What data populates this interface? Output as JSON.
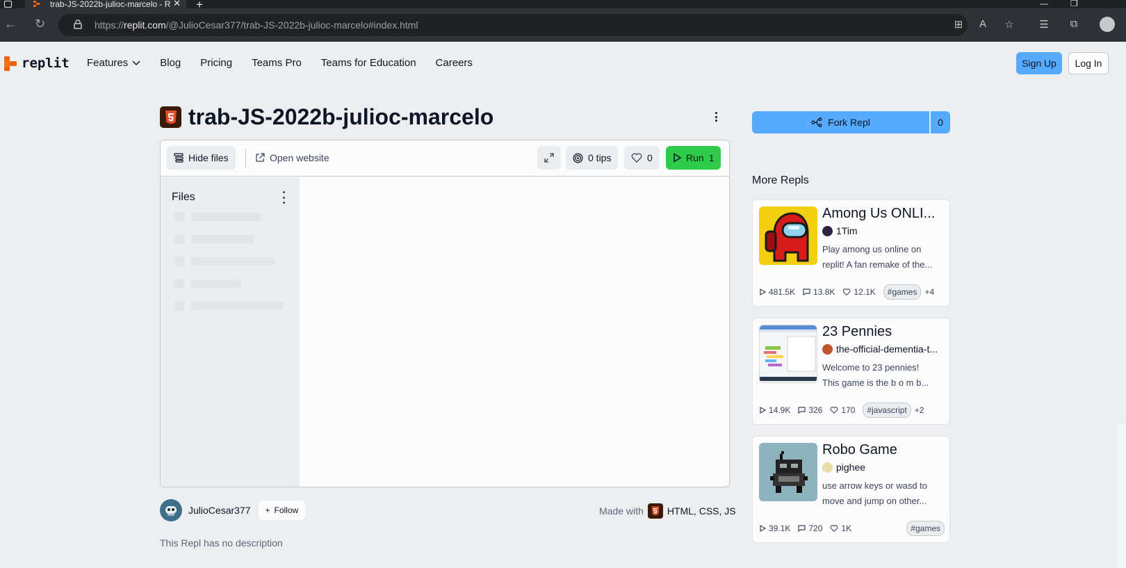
{
  "browser": {
    "tab_title": "trab-JS-2022b-julioc-marcelo - R",
    "url_prefix": "https://",
    "url_domain": "replit.com",
    "url_path": "/@JulioCesar377/trab-JS-2022b-julioc-marcelo#index.html"
  },
  "header": {
    "logo_text": "replit",
    "nav": [
      "Features",
      "Blog",
      "Pricing",
      "Teams Pro",
      "Teams for Education",
      "Careers"
    ],
    "signup": "Sign Up",
    "login": "Log In"
  },
  "repl": {
    "title": "trab-JS-2022b-julioc-marcelo",
    "hide_files": "Hide files",
    "open_website": "Open website",
    "tips": "0 tips",
    "likes": "0",
    "run_label": "Run",
    "run_count": "1",
    "files_title": "Files",
    "owner": "JulioCesar377",
    "follow": "Follow",
    "made_with_label": "Made with",
    "made_with_langs": "HTML, CSS, JS",
    "description": "This Repl has no description"
  },
  "sidebar": {
    "fork_label": "Fork Repl",
    "fork_count": "0",
    "more_title": "More Repls",
    "cards": [
      {
        "title": "Among Us ONLI...",
        "author": "1Tim",
        "desc1": "Play among us online on",
        "desc2": "replit! A fan remake of the...",
        "runs": "481.5K",
        "comments": "13.8K",
        "likes": "12.1K",
        "tag": "#games",
        "more_tags": "+4"
      },
      {
        "title": "23 Pennies",
        "author": "the-official-dementia-t...",
        "desc1": "Welcome to 23 pennies!",
        "desc2": "This game is the b o m b...",
        "runs": "14.9K",
        "comments": "326",
        "likes": "170",
        "tag": "#javascript",
        "more_tags": "+2"
      },
      {
        "title": "Robo Game",
        "author": "pighee",
        "desc1": "use arrow keys or wasd to",
        "desc2": "move and jump on other...",
        "runs": "39.1K",
        "comments": "720",
        "likes": "1K",
        "tag": "#games",
        "more_tags": ""
      }
    ]
  },
  "colors": {
    "accent_blue": "#57abff",
    "run_green": "#2ecc4a",
    "replit_orange": "#f26207",
    "page_bg": "#eceef0"
  }
}
